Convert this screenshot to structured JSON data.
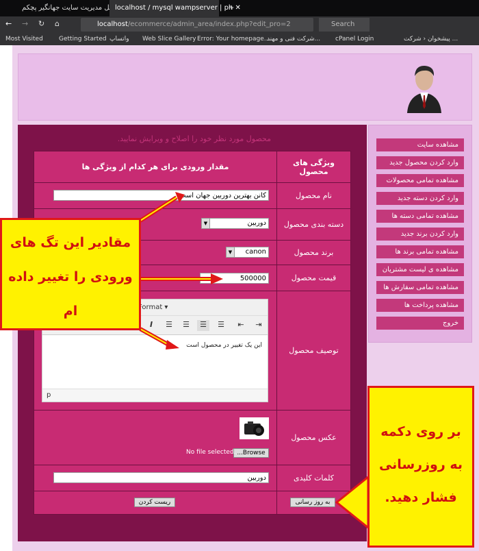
{
  "browser": {
    "tabs": [
      {
        "label": "پنل مدیریت سایت جهانگیر پچکم"
      },
      {
        "label": "localhost / mysql wampserver | ph"
      }
    ],
    "url_host": "localhost",
    "url_path": "/ecommerce/admin_area/index.php?edit_pro=2",
    "search_placeholder": "Search",
    "bookmarks": [
      "Most Visited",
      "Getting Started",
      "واتساپ",
      "Web Slice Gallery",
      "Error: Your homepage...",
      "شرکت فنی و مهند...",
      "cPanel Login",
      "پیشخوان ‹ شرکت ..."
    ]
  },
  "sidebar": {
    "items": [
      {
        "label": "مشاهده سایت"
      },
      {
        "label": "وارد کردن محصول جدید"
      },
      {
        "label": "مشاهده تمامی محصولات"
      },
      {
        "label": "وارد کردن دسته جدید"
      },
      {
        "label": "مشاهده تمامی دسته ها"
      },
      {
        "label": "وارد کردن برند جدید"
      },
      {
        "label": "مشاهده تمامی برند ها"
      },
      {
        "label": "مشاهده ی لیست مشتریان"
      },
      {
        "label": "مشاهده تمامی سفارش ها"
      },
      {
        "label": "مشاهده پرداخت ها"
      },
      {
        "label": "خروج"
      }
    ]
  },
  "form": {
    "intro": "محصول مورد نظر خود را اصلاح و ویرایش نمایید.",
    "col_attr": "ویژگی های محصول",
    "col_value": "مقدار ورودی برای هر کدام از ویژگی ها",
    "name_label": "نام محصول",
    "name_value": "کانن بهترین دوربین جهان است",
    "category_label": "دسته بندی محصول",
    "category_value": "دوربین",
    "brand_label": "برند محصول",
    "brand_value": "canon",
    "price_label": "قیمت محصول",
    "price_value": "500000",
    "desc_label": "توصیف محصول",
    "editor_format": "Format ▾",
    "desc_value": "این یک تغییر در محصول است",
    "editor_status": "p",
    "image_label": "عکس محصول",
    "browse_label": "Browse...",
    "no_file": "No file selected.",
    "keywords_label": "کلمات کلیدی",
    "keywords_value": "دوربین",
    "update_button": "به روز رسانی",
    "reset_button": "ریست کردن"
  },
  "callouts": {
    "left": "مقادیر این تگ های ورودی را تغییر داده ام",
    "right": "بر روی دکمه به روزرسانی فشار دهید."
  },
  "colors": {
    "main": "#7e1249",
    "cell": "#c82b73",
    "sidebar_button": "#c3397b",
    "callout": "#fff200"
  }
}
